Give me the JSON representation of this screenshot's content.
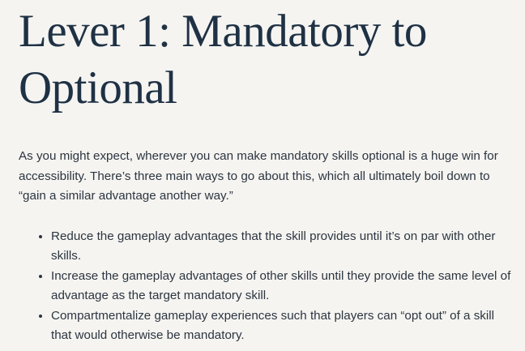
{
  "heading": "Lever 1: Mandatory to Optional",
  "intro": "As you might expect, wherever you can make mandatory skills optional is a huge win for accessibility. There’s three main ways to go about this, which all ultimately boil down to “gain a similar advantage another way.”",
  "bullets": [
    "Reduce the gameplay advantages that the skill provides until it’s on par with other skills.",
    "Increase the gameplay advantages of other skills until they provide the same level of advantage as the target mandatory skill.",
    "Compartmentalize gameplay experiences such that players can “opt out” of a skill that would otherwise be mandatory."
  ]
}
